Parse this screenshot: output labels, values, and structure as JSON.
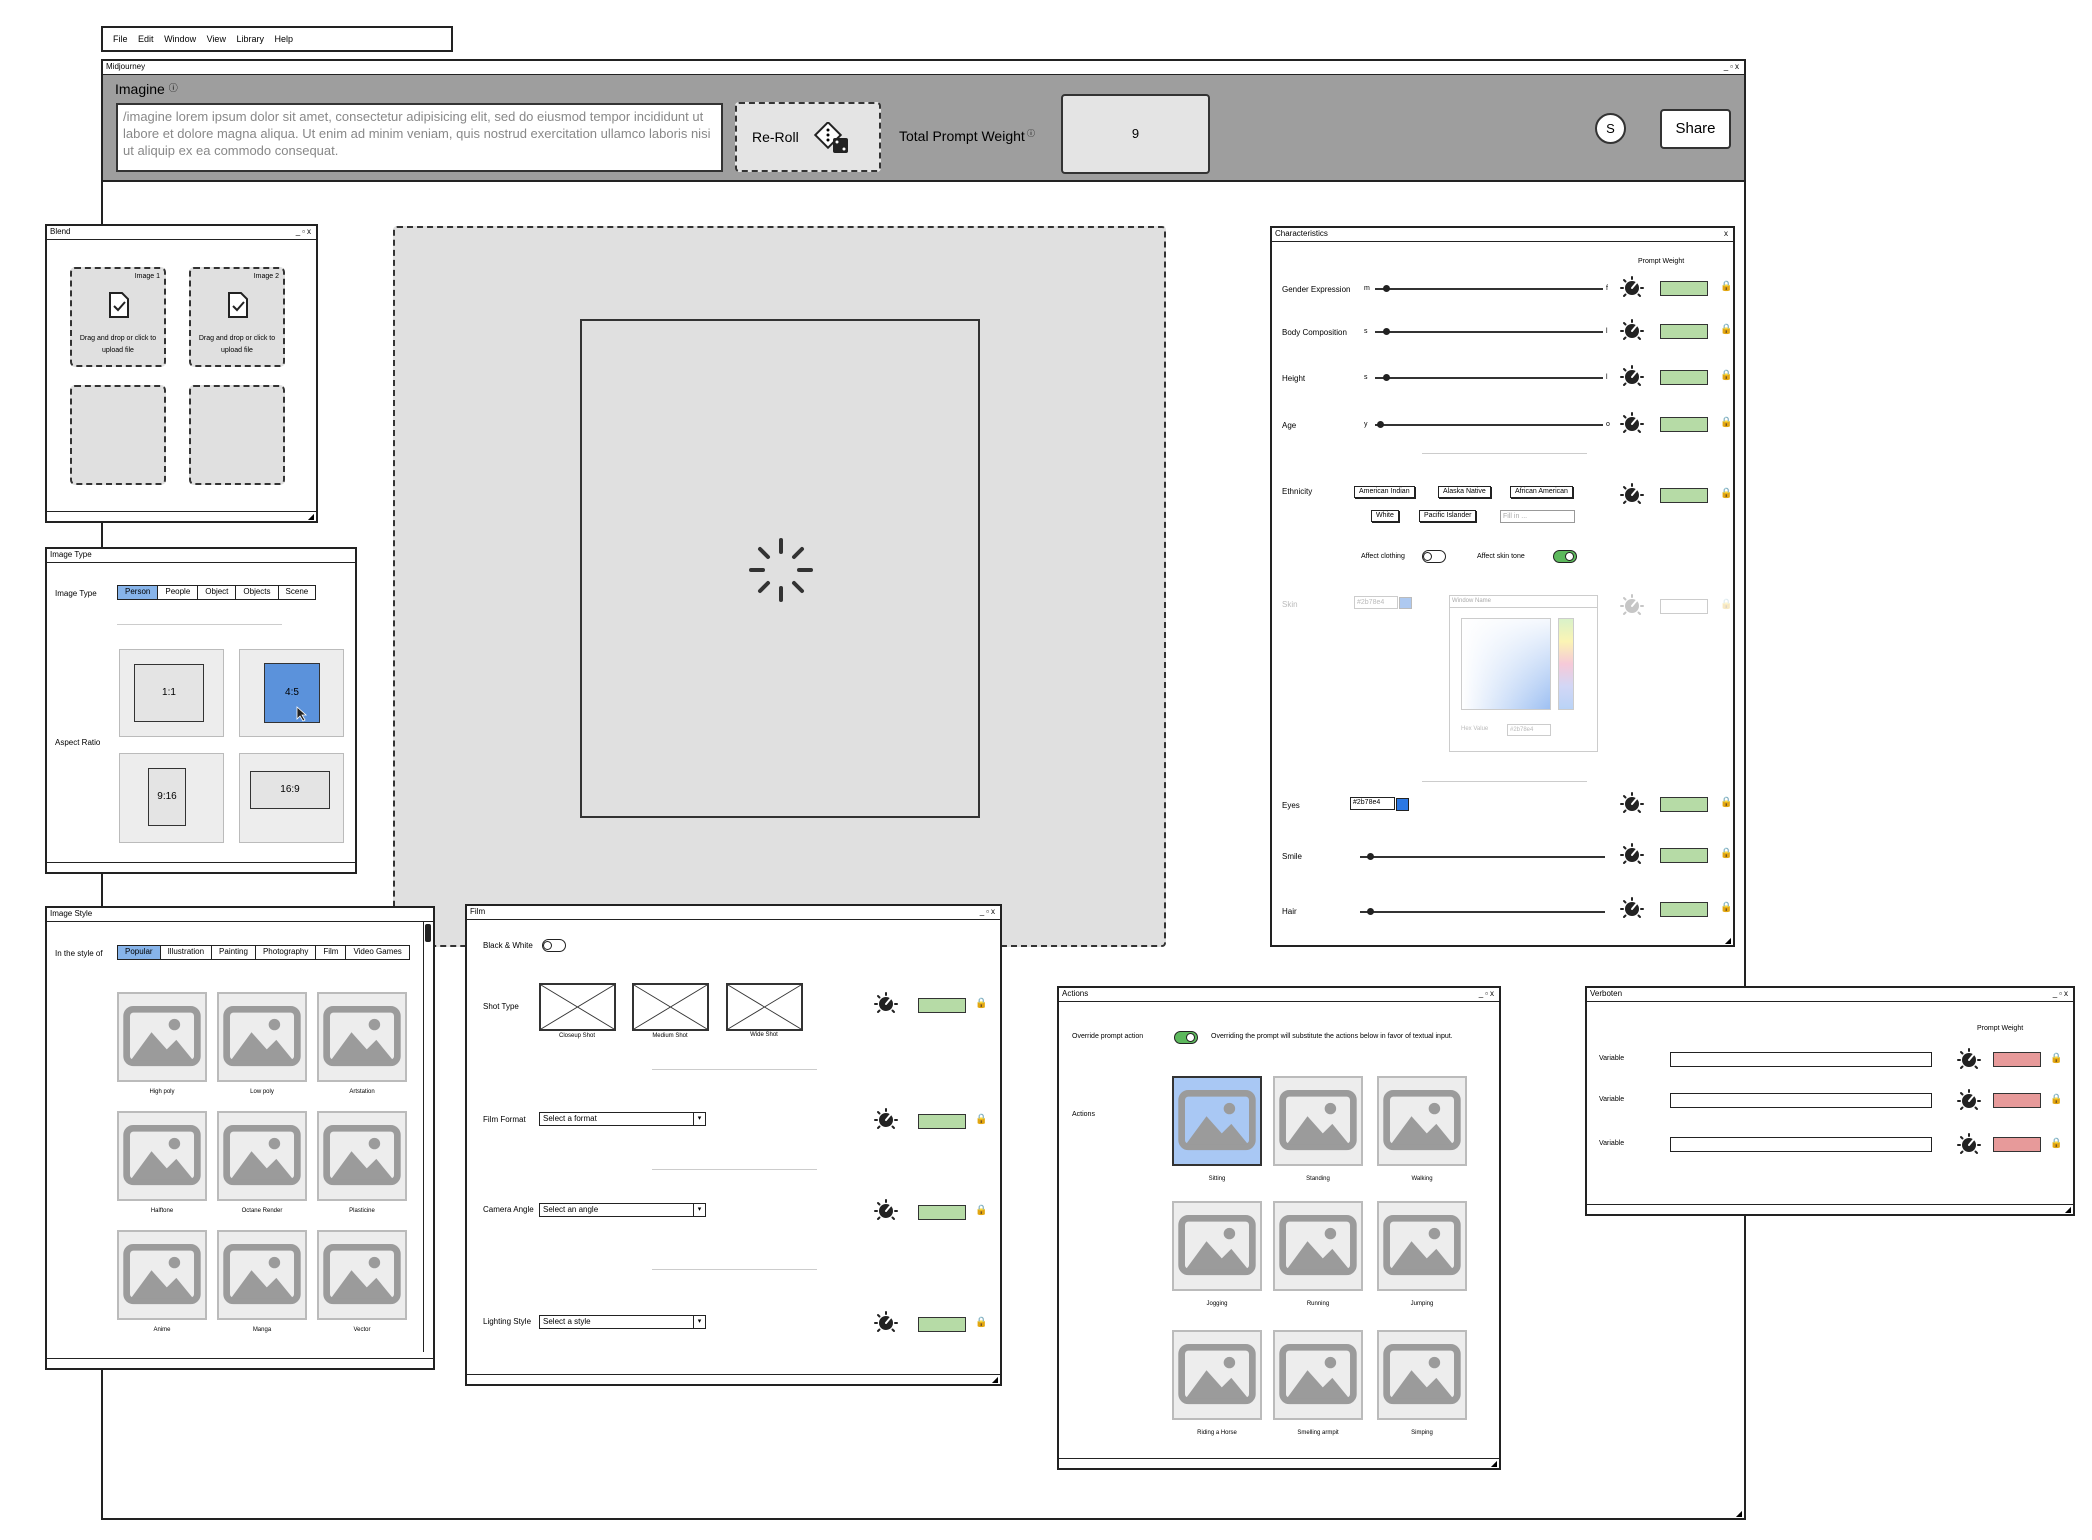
{
  "menubar": {
    "items": [
      "File",
      "Edit",
      "Window",
      "View",
      "Library",
      "Help"
    ]
  },
  "main_window": {
    "title": "Midjourney"
  },
  "imagine": {
    "title": "Imagine",
    "prompt": "/imagine lorem ipsum dolor sit amet, consectetur adipisicing elit, sed do eiusmod tempor incididunt ut labore et dolore magna aliqua. Ut enim ad minim veniam, quis nostrud exercitation ullamco laboris nisi ut aliquip ex ea commodo consequat.",
    "reroll": "Re-Roll",
    "total_weight_label": "Total Prompt Weight",
    "total_weight_value": "9",
    "avatar": "S",
    "share": "Share"
  },
  "blend": {
    "title": "Blend",
    "slots": [
      {
        "label": "Image 1",
        "hint": "Drag and drop or click to upload file"
      },
      {
        "label": "Image 2",
        "hint": "Drag and drop or click to upload file"
      }
    ]
  },
  "image_type": {
    "title": "Image Type",
    "type_label": "Image Type",
    "tabs": [
      "Person",
      "People",
      "Object",
      "Objects",
      "Scene"
    ],
    "active_tab": "Person",
    "aspect_label": "Aspect Ratio",
    "ratios": [
      "1:1",
      "4:5",
      "9:16",
      "16:9"
    ],
    "selected_ratio": "4:5"
  },
  "image_style": {
    "title": "Image Style",
    "style_label": "In the style of",
    "tabs": [
      "Popular",
      "Illustration",
      "Painting",
      "Photography",
      "Film",
      "Video Games"
    ],
    "active_tab": "Popular",
    "items": [
      "High poly",
      "Low poly",
      "Artstation",
      "Halftone",
      "Octane Render",
      "Plasticine",
      "Anime",
      "Manga",
      "Vector"
    ]
  },
  "film": {
    "title": "Film",
    "bw_label": "Black & White",
    "shot_label": "Shot Type",
    "shots": [
      "Closeup Shot",
      "Medium Shot",
      "Wide Shot"
    ],
    "format_label": "Film Format",
    "format_placeholder": "Select a format",
    "angle_label": "Camera Angle",
    "angle_placeholder": "Select an angle",
    "lighting_label": "Lighting Style",
    "lighting_placeholder": "Select a style"
  },
  "characteristics": {
    "title": "Characteristics",
    "weight_header": "Prompt Weight",
    "rows": [
      {
        "label": "Gender Expression",
        "min": "m",
        "max": "f",
        "value": 0.05
      },
      {
        "label": "Body Composition",
        "min": "s",
        "max": "l",
        "value": 0.05
      },
      {
        "label": "Height",
        "min": "s",
        "max": "l",
        "value": 0.05
      },
      {
        "label": "Age",
        "min": "y",
        "max": "o",
        "value": 0.02
      }
    ],
    "ethnicity_label": "Ethnicity",
    "ethnicities": [
      "American Indian",
      "Alaska Native",
      "African American",
      "White",
      "Pacific Islander"
    ],
    "fill_placeholder": "Fill in ...",
    "affect_clothing": "Affect clothing",
    "affect_skin": "Affect skin tone",
    "skin_label": "Skin",
    "skin_hex": "#2b78e4",
    "picker_title": "Window Name",
    "picker_hex_label": "Hex Value",
    "picker_hex": "#2b78e4",
    "eyes_label": "Eyes",
    "eyes_hex": "#2b78e4",
    "smile_label": "Smile",
    "smile_value": 0.04,
    "hair_label": "Hair",
    "hair_value": 0.04
  },
  "actions": {
    "title": "Actions",
    "override_label": "Override prompt action",
    "override_note": "Overriding the prompt will substitute the actions below in favor of textual input.",
    "actions_label": "Actions",
    "items": [
      "Sitting",
      "Standing",
      "Walking",
      "Jogging",
      "Running",
      "Jumping",
      "Riding a Horse",
      "Smelling armpit",
      "Simping"
    ],
    "selected": "Sitting"
  },
  "verboten": {
    "title": "Verboten",
    "weight_header": "Prompt Weight",
    "rows": [
      "Variable",
      "Variable",
      "Variable"
    ]
  },
  "colors": {
    "accent": "#87b4ea",
    "selected_ratio": "#5b92db",
    "weight_green": "#b6dba6",
    "weight_red": "#e79a9a",
    "header_gray": "#9e9e9e",
    "canvas_gray": "#e0e0e0"
  }
}
